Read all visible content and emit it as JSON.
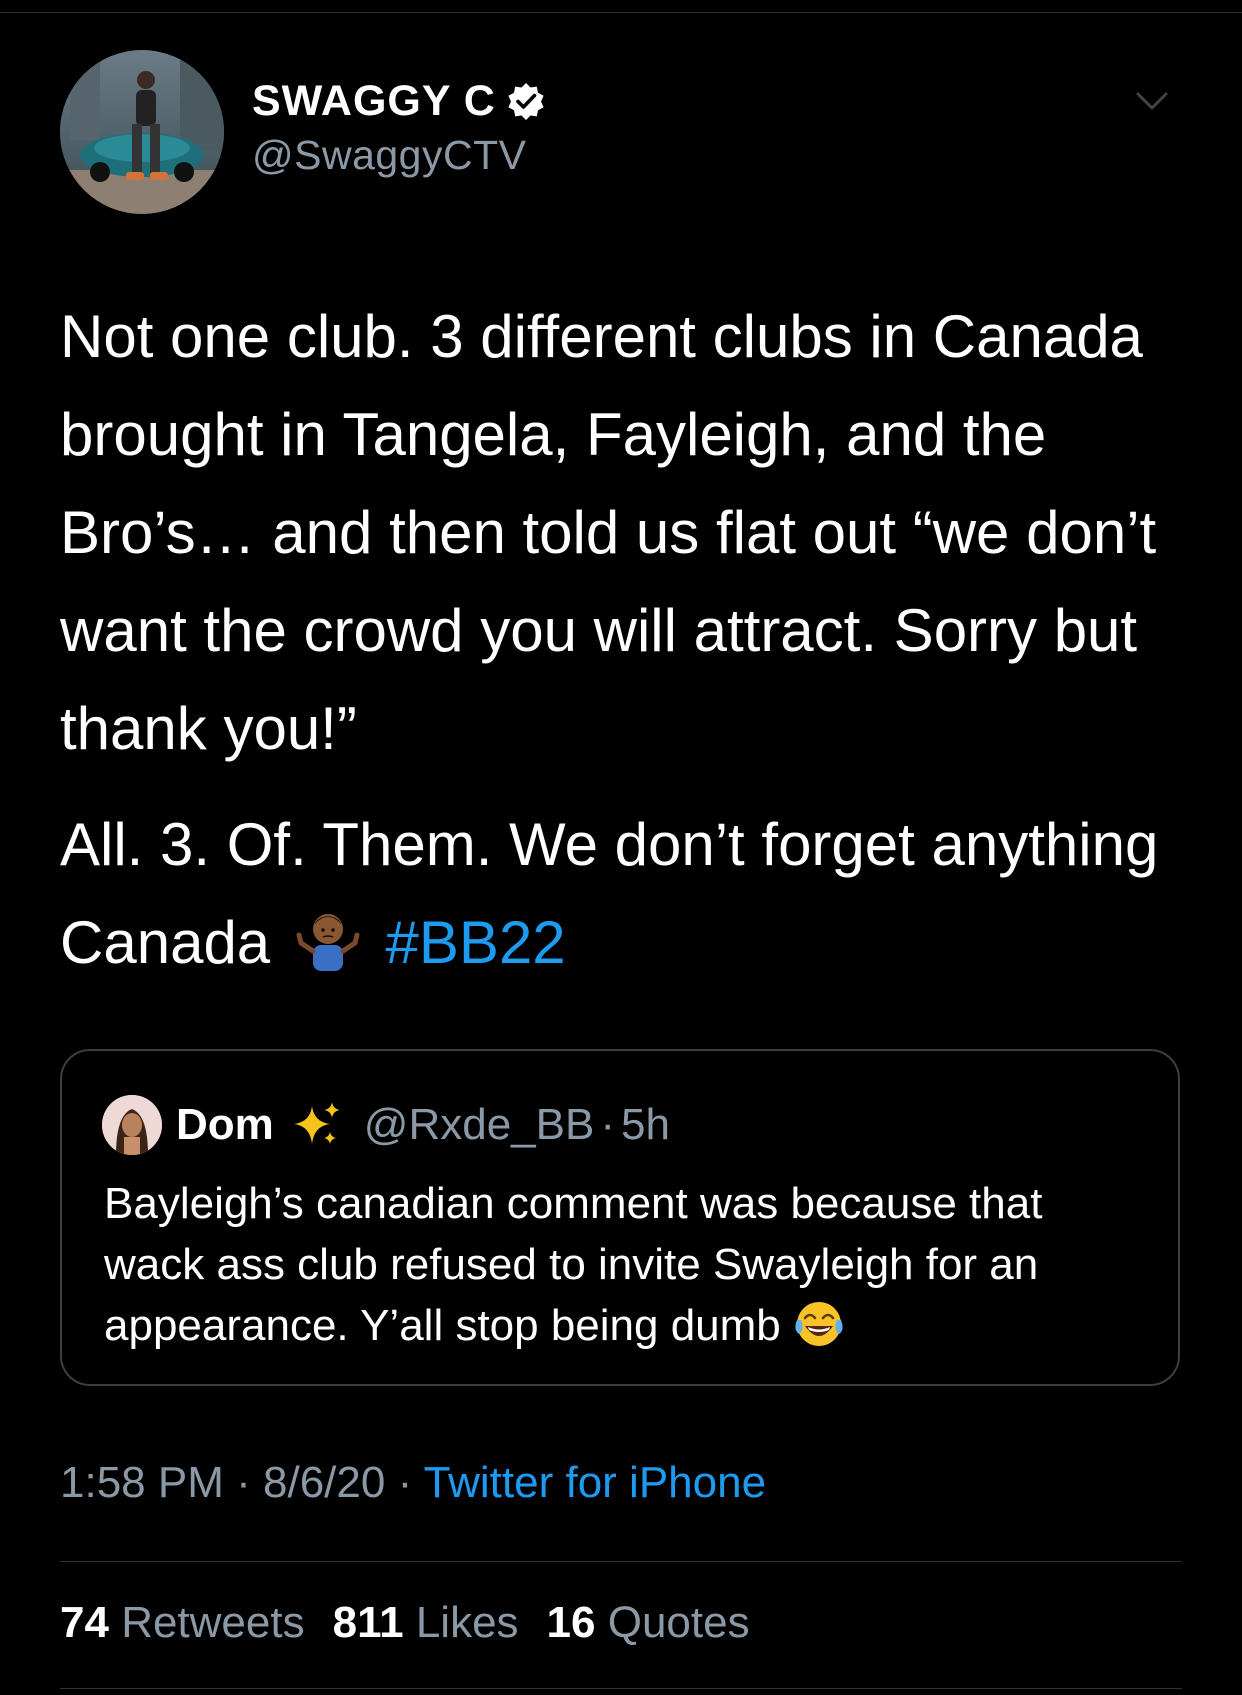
{
  "author": {
    "display_name": "SWAGGY C",
    "handle": "@SwaggyCTV",
    "verified": true
  },
  "tweet": {
    "paragraph_1": "Not one club. 3 different clubs in Canada brought in Tangela, Fayleigh, and the Bro’s… and then told us flat out “we don’t want the crowd you will attract. Sorry but thank you!”",
    "paragraph_2_text": "All. 3. Of. Them. We don’t forget anything Canada",
    "emoji": "person-shrugging",
    "hashtag": "#BB22"
  },
  "quoted_tweet": {
    "name": "Dom",
    "name_emoji": "sparkles",
    "handle": "@Rxde_BB",
    "separator": "·",
    "age": "5h",
    "text": "Bayleigh’s canadian comment was because that wack ass club refused to invite Swayleigh for an appearance. Y’all stop being dumb",
    "trailing_emoji": "face-with-tears-of-joy"
  },
  "meta": {
    "time": "1:58 PM",
    "date": "8/6/20",
    "separator": "·",
    "source": "Twitter for iPhone"
  },
  "stats": {
    "retweets_count": "74",
    "retweets_label": "Retweets",
    "likes_count": "811",
    "likes_label": "Likes",
    "quotes_count": "16",
    "quotes_label": "Quotes"
  },
  "colors": {
    "background": "#000000",
    "link": "#1d9bf0",
    "secondary_text": "#8b98a5",
    "divider": "#2f3336"
  }
}
